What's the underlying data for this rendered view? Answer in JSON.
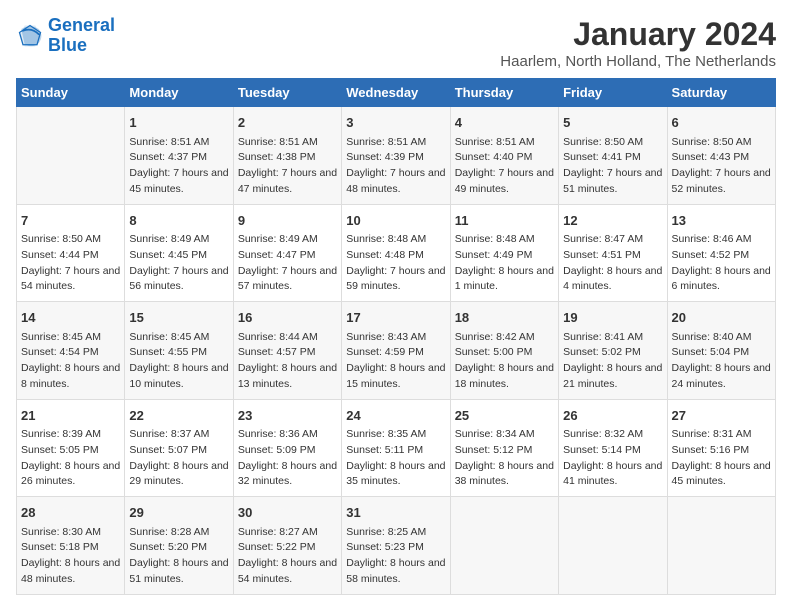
{
  "logo": {
    "text_general": "General",
    "text_blue": "Blue"
  },
  "header": {
    "title": "January 2024",
    "subtitle": "Haarlem, North Holland, The Netherlands"
  },
  "days_of_week": [
    "Sunday",
    "Monday",
    "Tuesday",
    "Wednesday",
    "Thursday",
    "Friday",
    "Saturday"
  ],
  "weeks": [
    [
      {
        "day": "",
        "content": ""
      },
      {
        "day": "1",
        "content": "Sunrise: 8:51 AM\nSunset: 4:37 PM\nDaylight: 7 hours and 45 minutes."
      },
      {
        "day": "2",
        "content": "Sunrise: 8:51 AM\nSunset: 4:38 PM\nDaylight: 7 hours and 47 minutes."
      },
      {
        "day": "3",
        "content": "Sunrise: 8:51 AM\nSunset: 4:39 PM\nDaylight: 7 hours and 48 minutes."
      },
      {
        "day": "4",
        "content": "Sunrise: 8:51 AM\nSunset: 4:40 PM\nDaylight: 7 hours and 49 minutes."
      },
      {
        "day": "5",
        "content": "Sunrise: 8:50 AM\nSunset: 4:41 PM\nDaylight: 7 hours and 51 minutes."
      },
      {
        "day": "6",
        "content": "Sunrise: 8:50 AM\nSunset: 4:43 PM\nDaylight: 7 hours and 52 minutes."
      }
    ],
    [
      {
        "day": "7",
        "content": "Sunrise: 8:50 AM\nSunset: 4:44 PM\nDaylight: 7 hours and 54 minutes."
      },
      {
        "day": "8",
        "content": "Sunrise: 8:49 AM\nSunset: 4:45 PM\nDaylight: 7 hours and 56 minutes."
      },
      {
        "day": "9",
        "content": "Sunrise: 8:49 AM\nSunset: 4:47 PM\nDaylight: 7 hours and 57 minutes."
      },
      {
        "day": "10",
        "content": "Sunrise: 8:48 AM\nSunset: 4:48 PM\nDaylight: 7 hours and 59 minutes."
      },
      {
        "day": "11",
        "content": "Sunrise: 8:48 AM\nSunset: 4:49 PM\nDaylight: 8 hours and 1 minute."
      },
      {
        "day": "12",
        "content": "Sunrise: 8:47 AM\nSunset: 4:51 PM\nDaylight: 8 hours and 4 minutes."
      },
      {
        "day": "13",
        "content": "Sunrise: 8:46 AM\nSunset: 4:52 PM\nDaylight: 8 hours and 6 minutes."
      }
    ],
    [
      {
        "day": "14",
        "content": "Sunrise: 8:45 AM\nSunset: 4:54 PM\nDaylight: 8 hours and 8 minutes."
      },
      {
        "day": "15",
        "content": "Sunrise: 8:45 AM\nSunset: 4:55 PM\nDaylight: 8 hours and 10 minutes."
      },
      {
        "day": "16",
        "content": "Sunrise: 8:44 AM\nSunset: 4:57 PM\nDaylight: 8 hours and 13 minutes."
      },
      {
        "day": "17",
        "content": "Sunrise: 8:43 AM\nSunset: 4:59 PM\nDaylight: 8 hours and 15 minutes."
      },
      {
        "day": "18",
        "content": "Sunrise: 8:42 AM\nSunset: 5:00 PM\nDaylight: 8 hours and 18 minutes."
      },
      {
        "day": "19",
        "content": "Sunrise: 8:41 AM\nSunset: 5:02 PM\nDaylight: 8 hours and 21 minutes."
      },
      {
        "day": "20",
        "content": "Sunrise: 8:40 AM\nSunset: 5:04 PM\nDaylight: 8 hours and 24 minutes."
      }
    ],
    [
      {
        "day": "21",
        "content": "Sunrise: 8:39 AM\nSunset: 5:05 PM\nDaylight: 8 hours and 26 minutes."
      },
      {
        "day": "22",
        "content": "Sunrise: 8:37 AM\nSunset: 5:07 PM\nDaylight: 8 hours and 29 minutes."
      },
      {
        "day": "23",
        "content": "Sunrise: 8:36 AM\nSunset: 5:09 PM\nDaylight: 8 hours and 32 minutes."
      },
      {
        "day": "24",
        "content": "Sunrise: 8:35 AM\nSunset: 5:11 PM\nDaylight: 8 hours and 35 minutes."
      },
      {
        "day": "25",
        "content": "Sunrise: 8:34 AM\nSunset: 5:12 PM\nDaylight: 8 hours and 38 minutes."
      },
      {
        "day": "26",
        "content": "Sunrise: 8:32 AM\nSunset: 5:14 PM\nDaylight: 8 hours and 41 minutes."
      },
      {
        "day": "27",
        "content": "Sunrise: 8:31 AM\nSunset: 5:16 PM\nDaylight: 8 hours and 45 minutes."
      }
    ],
    [
      {
        "day": "28",
        "content": "Sunrise: 8:30 AM\nSunset: 5:18 PM\nDaylight: 8 hours and 48 minutes."
      },
      {
        "day": "29",
        "content": "Sunrise: 8:28 AM\nSunset: 5:20 PM\nDaylight: 8 hours and 51 minutes."
      },
      {
        "day": "30",
        "content": "Sunrise: 8:27 AM\nSunset: 5:22 PM\nDaylight: 8 hours and 54 minutes."
      },
      {
        "day": "31",
        "content": "Sunrise: 8:25 AM\nSunset: 5:23 PM\nDaylight: 8 hours and 58 minutes."
      },
      {
        "day": "",
        "content": ""
      },
      {
        "day": "",
        "content": ""
      },
      {
        "day": "",
        "content": ""
      }
    ]
  ]
}
